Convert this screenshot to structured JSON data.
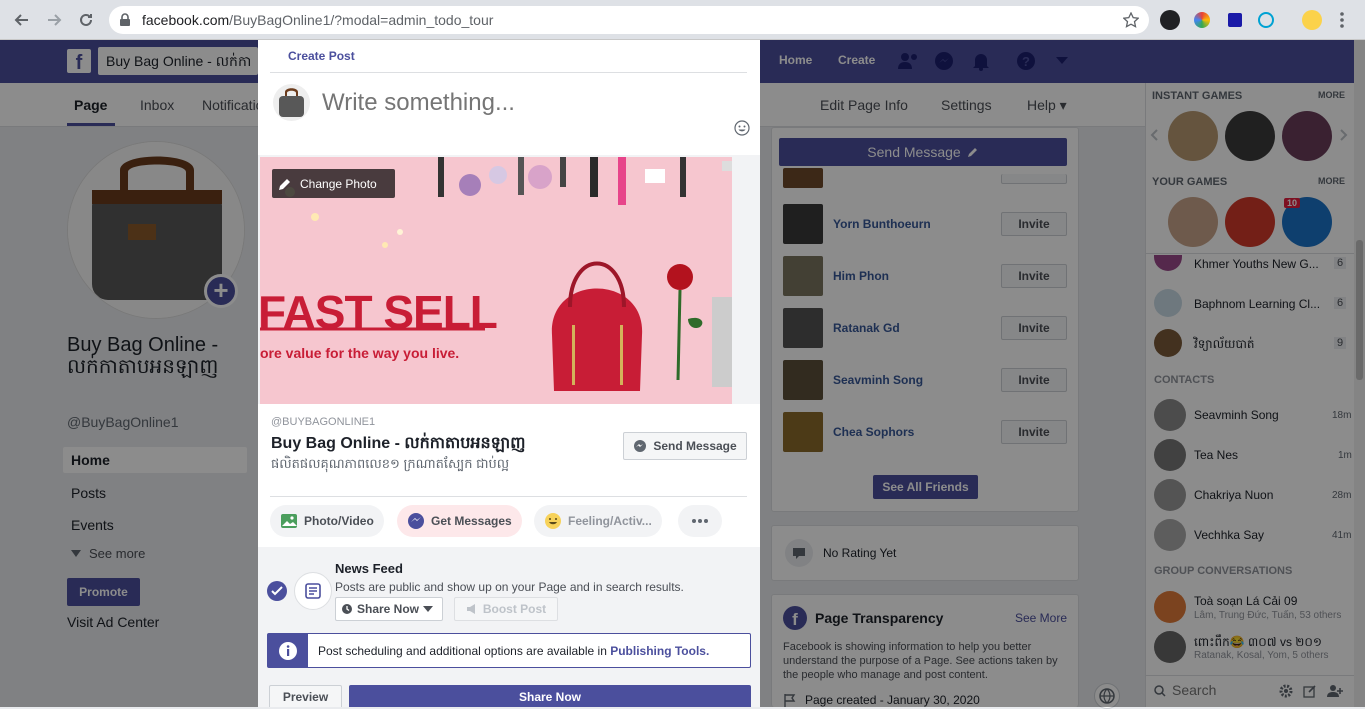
{
  "browser": {
    "url_host": "facebook.com",
    "url_path": "/BuyBagOnline1/?modal=admin_todo_tour"
  },
  "fb_header": {
    "page_name_field": "Buy Bag Online - លក់កា",
    "links": [
      "Home",
      "Create"
    ]
  },
  "page_tabs": {
    "left": [
      "Page",
      "Inbox",
      "Notificatio"
    ],
    "right": [
      "Edit Page Info",
      "Settings",
      "Help ▾"
    ]
  },
  "left_column": {
    "page_title": "Buy Bag Online - លក់កាតាបអនឡាញ",
    "handle": "@BuyBagOnline1",
    "nav": [
      "Home",
      "Posts",
      "Events"
    ],
    "see_more": "See more",
    "promote": "Promote",
    "visit_ad_center": "Visit Ad Center"
  },
  "middle_right": {
    "send_message": "Send Message",
    "friends": [
      {
        "name": "Yorn Bunthoeurn",
        "invite": "Invite"
      },
      {
        "name": "Him Phon",
        "invite": "Invite"
      },
      {
        "name": "Ratanak Gd",
        "invite": "Invite"
      },
      {
        "name": "Seavminh Song",
        "invite": "Invite"
      },
      {
        "name": "Chea Sophors",
        "invite": "Invite"
      }
    ],
    "see_all_friends": "See All Friends",
    "no_rating": "No Rating Yet",
    "transparency_title": "Page Transparency",
    "transparency_see_more": "See More",
    "transparency_body": "Facebook is showing information to help you better understand the purpose of a Page. See actions taken by the people who manage and post content.",
    "page_created": "Page created - January 30, 2020"
  },
  "right_panel": {
    "instant_games": "INSTANT GAMES",
    "your_games": "YOUR GAMES",
    "more": "MORE",
    "game_badge": "10",
    "groups": [
      {
        "name": "Khmer Youths New G...",
        "count": "6"
      },
      {
        "name": "Baphnom Learning Cl...",
        "count": "6"
      },
      {
        "name": "វិទ្យាល័យបាត់",
        "count": "9"
      }
    ],
    "contacts_label": "CONTACTS",
    "contacts": [
      {
        "name": "Seavminh Song",
        "time": "18m"
      },
      {
        "name": "Tea Nes",
        "time": "1m"
      },
      {
        "name": "Chakriya Nuon",
        "time": "28m"
      },
      {
        "name": "Vechhka Say",
        "time": "41m"
      }
    ],
    "group_conv_label": "GROUP CONVERSATIONS",
    "group_convs": [
      {
        "name": "Toà soạn Lá Cải 09",
        "sub": "Lâm, Trung Đức, Tuấn, 53 others"
      },
      {
        "name": "ពោះពឹក😂 ៣០៧ vs ២០១",
        "sub": "Ratanak, Kosal, Yom, 5 others"
      }
    ],
    "search_placeholder": "Search"
  },
  "modal": {
    "header": "Create Post",
    "placeholder": "Write something...",
    "change_photo": "Change Photo",
    "banner_text": "FAST SELL",
    "banner_sub": "ore value for the way you live.",
    "handle": "@BUYBAGONLINE1",
    "page_name": "Buy Bag Online - លក់កាតាបអនឡាញ",
    "page_sub": "ផលិតផលគុណភាពលេខ១ ក្រណាតស្បែក ជាប់ល្អ",
    "send_message": "Send Message",
    "actions": [
      "Photo/Video",
      "Get Messages",
      "Feeling/Activ..."
    ],
    "newsfeed_title": "News Feed",
    "newsfeed_desc": "Posts are public and show up on your Page and in search results.",
    "share_now_dropdown": "Share Now",
    "boost_post": "Boost Post",
    "info_text": "Post scheduling and additional options are available in ",
    "info_link": "Publishing Tools.",
    "preview": "Preview",
    "share_now": "Share Now"
  },
  "colors": {
    "fb_bar": "#4b4f9d",
    "accent": "#4b4f9d",
    "link": "#385898",
    "banner_bg": "#f6c6cf"
  }
}
